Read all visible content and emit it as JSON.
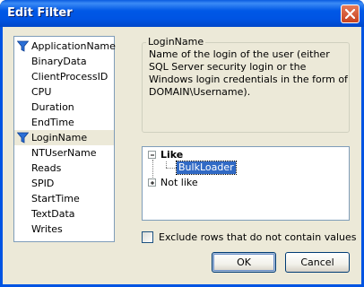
{
  "window": {
    "title": "Edit Filter",
    "close_icon": "close-icon"
  },
  "fields": {
    "items": [
      {
        "label": "ApplicationName",
        "filtered": true
      },
      {
        "label": "BinaryData",
        "filtered": false
      },
      {
        "label": "ClientProcessID",
        "filtered": false
      },
      {
        "label": "CPU",
        "filtered": false
      },
      {
        "label": "Duration",
        "filtered": false
      },
      {
        "label": "EndTime",
        "filtered": false
      },
      {
        "label": "LoginName",
        "filtered": true,
        "selected": true
      },
      {
        "label": "NTUserName",
        "filtered": false
      },
      {
        "label": "Reads",
        "filtered": false
      },
      {
        "label": "SPID",
        "filtered": false
      },
      {
        "label": "StartTime",
        "filtered": false
      },
      {
        "label": "TextData",
        "filtered": false
      },
      {
        "label": "Writes",
        "filtered": false
      }
    ]
  },
  "description": {
    "title": "LoginName",
    "text": "Name of the login of the user (either SQL Server security login or the Windows login credentials in the form of DOMAIN\\Username)."
  },
  "conditions": {
    "like": {
      "label": "Like",
      "expander": "−",
      "values": [
        "BulkLoader"
      ]
    },
    "not_like": {
      "label": "Not like",
      "expander": "+"
    }
  },
  "options": {
    "exclude_label": "Exclude rows that do not contain values",
    "exclude_checked": false
  },
  "buttons": {
    "ok": "OK",
    "cancel": "Cancel"
  },
  "colors": {
    "titlebar": "#0054e3",
    "dialog_bg": "#ece9d8",
    "selection": "#316ac5",
    "funnel": "#2b6fd6"
  }
}
